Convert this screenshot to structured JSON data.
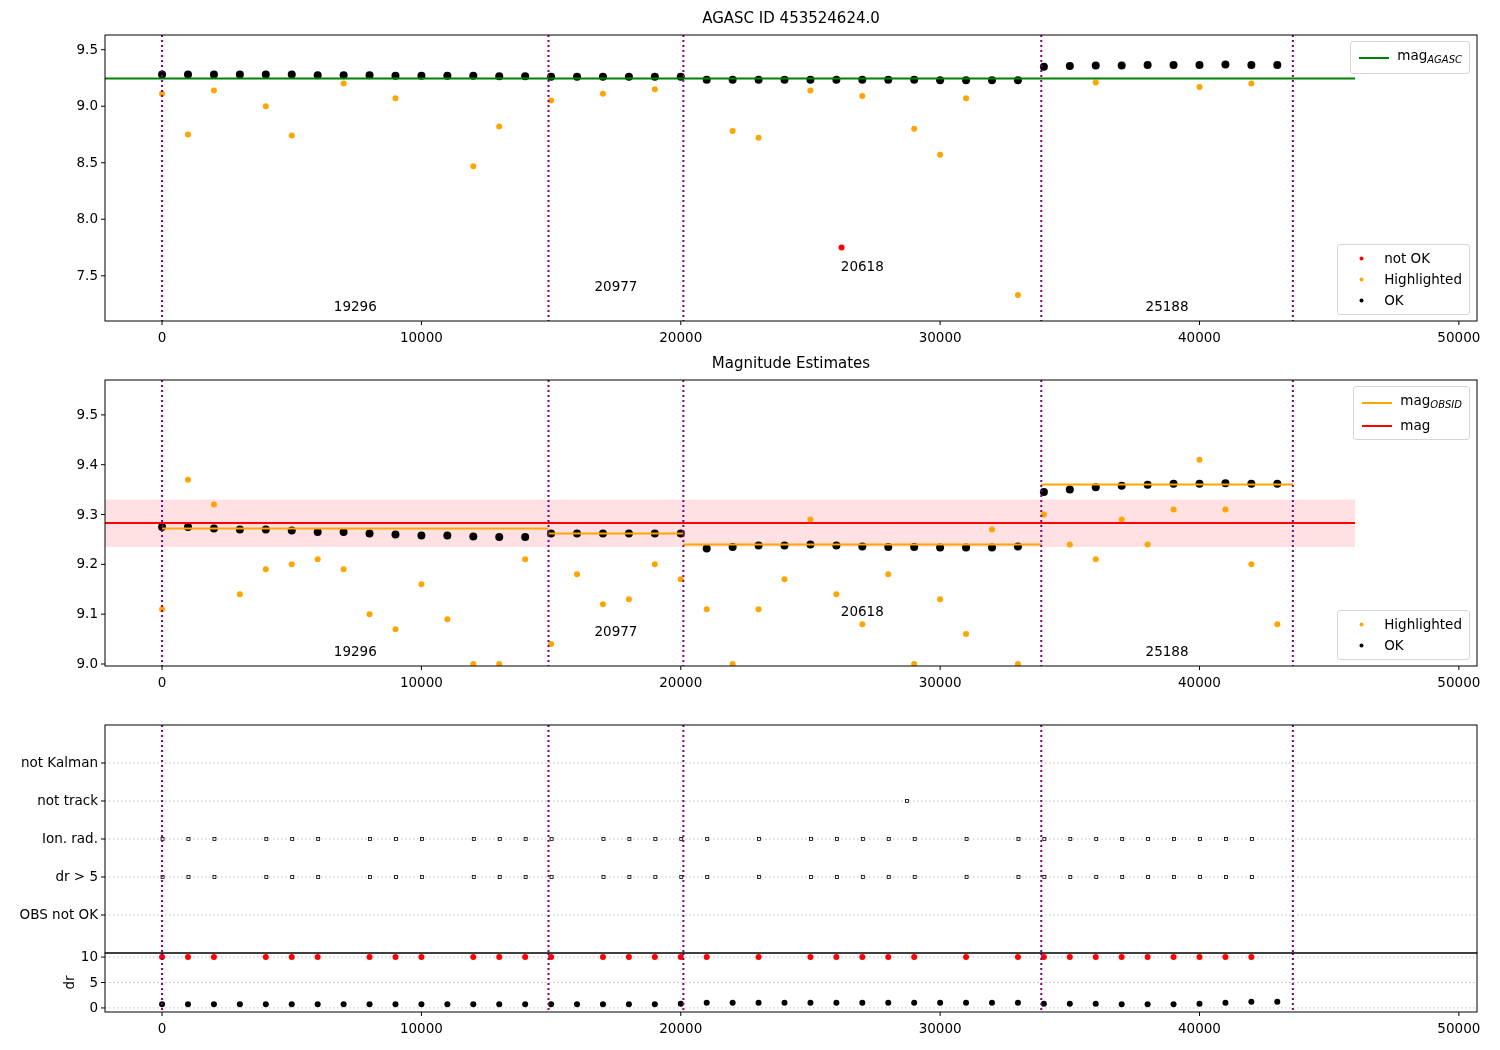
{
  "panels": [
    {
      "subplots": [
        {
          "chart_data": {
            "type": "scatter",
            "title": "AGASC ID 453524624.0",
            "xlim": [
              -2200,
              50700
            ],
            "ylim": [
              7.1,
              9.63
            ],
            "xticks": [
              0,
              10000,
              20000,
              30000,
              40000,
              50000
            ],
            "yticks": [
              {
                "value": 7.5,
                "label": "7.5"
              },
              {
                "value": 8,
                "label": "8.0"
              },
              {
                "value": 8.5,
                "label": "8.5"
              },
              {
                "value": 9,
                "label": "9.0"
              },
              {
                "value": 9.5,
                "label": "9.5"
              }
            ],
            "series": [
              {
                "type": "line",
                "color": "#008000",
                "x": [
                  -2200,
                  46000
                ],
                "values": [
                  9.245,
                  9.245
                ]
              },
              {
                "type": "scatter",
                "color": "#ff0000",
                "x": [
                  26200
                ],
                "values": [
                  7.75
                ]
              },
              {
                "type": "scatter",
                "color": "#ffa500",
                "x": [
                  0,
                  1000,
                  2000,
                  4000,
                  5000,
                  7000,
                  9000,
                  12000,
                  13000,
                  15000,
                  17000,
                  19000,
                  22000,
                  23000,
                  25000,
                  27000,
                  29000,
                  30000,
                  31000,
                  33000,
                  36000,
                  40000,
                  42000
                ],
                "values": [
                  9.11,
                  8.75,
                  9.14,
                  9.0,
                  8.74,
                  9.2,
                  9.07,
                  8.47,
                  8.82,
                  9.05,
                  9.11,
                  9.15,
                  8.78,
                  8.72,
                  9.14,
                  9.09,
                  8.8,
                  8.57,
                  9.07,
                  7.33,
                  9.21,
                  9.17,
                  9.2
                ]
              },
              {
                "type": "scatter",
                "color": "#000000",
                "x": [
                  0,
                  1000,
                  2000,
                  3000,
                  4000,
                  5000,
                  6000,
                  7000,
                  8000,
                  9000,
                  10000,
                  11000,
                  12000,
                  13000,
                  14000,
                  15000,
                  16000,
                  17000,
                  18000,
                  19000,
                  20000,
                  21000,
                  22000,
                  23000,
                  24000,
                  25000,
                  26000,
                  27000,
                  28000,
                  29000,
                  30000,
                  31000,
                  32000,
                  33000,
                  34000,
                  35000,
                  36000,
                  37000,
                  38000,
                  39000,
                  40000,
                  41000,
                  42000,
                  43000
                ],
                "values": [
                  9.28,
                  9.28,
                  9.28,
                  9.28,
                  9.28,
                  9.28,
                  9.275,
                  9.275,
                  9.275,
                  9.27,
                  9.27,
                  9.27,
                  9.27,
                  9.265,
                  9.265,
                  9.26,
                  9.26,
                  9.26,
                  9.26,
                  9.26,
                  9.26,
                  9.235,
                  9.235,
                  9.235,
                  9.235,
                  9.235,
                  9.235,
                  9.235,
                  9.235,
                  9.235,
                  9.23,
                  9.23,
                  9.23,
                  9.23,
                  9.35,
                  9.355,
                  9.36,
                  9.36,
                  9.365,
                  9.365,
                  9.365,
                  9.37,
                  9.365,
                  9.365
                ]
              }
            ],
            "ref_lines": [
              {
                "axis": "x",
                "value": 0
              },
              {
                "axis": "x",
                "value": 14900
              },
              {
                "axis": "x",
                "value": 20100
              },
              {
                "axis": "x",
                "value": 33900
              },
              {
                "axis": "x",
                "value": 43600
              }
            ]
          },
          "obsid_labels": [
            "19296",
            "20977",
            "20618",
            "25188"
          ],
          "legends": [
            {
              "entries": [
                {
                  "label": "mag$_{AGASC}$",
                  "kind": "line",
                  "color": "#008000"
                }
              ]
            },
            {
              "entries": [
                {
                  "label": "not OK",
                  "kind": "dot",
                  "color": "#ff0000"
                },
                {
                  "label": "Highlighted",
                  "kind": "dot",
                  "color": "#ffa500"
                },
                {
                  "label": "OK",
                  "kind": "dot",
                  "color": "#000000"
                }
              ]
            }
          ]
        }
      ]
    },
    {
      "subplots": [
        {
          "chart_data": {
            "type": "scatter",
            "title": "Magnitude Estimates",
            "xlim": [
              -2200,
              50700
            ],
            "ylim": [
              8.996,
              9.57
            ],
            "xticks": [
              0,
              10000,
              20000,
              30000,
              40000,
              50000
            ],
            "yticks": [
              {
                "value": 9,
                "label": "9.0"
              },
              {
                "value": 9.1,
                "label": "9.1"
              },
              {
                "value": 9.2,
                "label": "9.2"
              },
              {
                "value": 9.3,
                "label": "9.3"
              },
              {
                "value": 9.4,
                "label": "9.4"
              },
              {
                "value": 9.5,
                "label": "9.5"
              }
            ],
            "series": [
              {
                "type": "line",
                "color": "#ffa500",
                "x": [
                  0,
                  14900
                ],
                "values": [
                  9.272,
                  9.272
                ]
              },
              {
                "type": "line",
                "color": "#ffa500",
                "x": [
                  14900,
                  20100
                ],
                "values": [
                  9.262,
                  9.262
                ]
              },
              {
                "type": "line",
                "color": "#ffa500",
                "x": [
                  20100,
                  33900
                ],
                "values": [
                  9.24,
                  9.24
                ]
              },
              {
                "type": "line",
                "color": "#ffa500",
                "x": [
                  33900,
                  43600
                ],
                "values": [
                  9.36,
                  9.36
                ]
              },
              {
                "type": "line",
                "color": "#ff0000",
                "x": [
                  -2200,
                  46000
                ],
                "values": [
                  9.283,
                  9.283
                ]
              },
              {
                "type": "scatter",
                "color": "#ffa500",
                "x": [
                  0,
                  1000,
                  2000,
                  3000,
                  4000,
                  5000,
                  6000,
                  7000,
                  8000,
                  9000,
                  10000,
                  11000,
                  12000,
                  13000,
                  14000,
                  15000,
                  16000,
                  17000,
                  18000,
                  19000,
                  20000,
                  21000,
                  22000,
                  23000,
                  24000,
                  25000,
                  26000,
                  27000,
                  28000,
                  29000,
                  30000,
                  31000,
                  32000,
                  33000,
                  34000,
                  35000,
                  36000,
                  37000,
                  38000,
                  39000,
                  40000,
                  41000,
                  42000,
                  43000
                ],
                "values": [
                  9.11,
                  9.37,
                  9.32,
                  9.14,
                  9.19,
                  9.2,
                  9.21,
                  9.19,
                  9.1,
                  9.07,
                  9.16,
                  9.09,
                  9.0,
                  9.0,
                  9.21,
                  9.04,
                  9.18,
                  9.12,
                  9.13,
                  9.2,
                  9.17,
                  9.11,
                  9.0,
                  9.11,
                  9.17,
                  9.29,
                  9.14,
                  9.08,
                  9.18,
                  9.0,
                  9.13,
                  9.06,
                  9.27,
                  9.0,
                  9.3,
                  9.24,
                  9.21,
                  9.29,
                  9.24,
                  9.31,
                  9.41,
                  9.31,
                  9.2,
                  9.08
                ]
              },
              {
                "type": "scatter",
                "color": "#000000",
                "x": [
                  0,
                  1000,
                  2000,
                  3000,
                  4000,
                  5000,
                  6000,
                  7000,
                  8000,
                  9000,
                  10000,
                  11000,
                  12000,
                  13000,
                  14000,
                  15000,
                  16000,
                  17000,
                  18000,
                  19000,
                  20000,
                  21000,
                  22000,
                  23000,
                  24000,
                  25000,
                  26000,
                  27000,
                  28000,
                  29000,
                  30000,
                  31000,
                  32000,
                  33000,
                  34000,
                  35000,
                  36000,
                  37000,
                  38000,
                  39000,
                  40000,
                  41000,
                  42000,
                  43000
                ],
                "values": [
                  9.275,
                  9.275,
                  9.272,
                  9.27,
                  9.27,
                  9.268,
                  9.265,
                  9.265,
                  9.262,
                  9.26,
                  9.258,
                  9.258,
                  9.256,
                  9.255,
                  9.255,
                  9.262,
                  9.262,
                  9.262,
                  9.262,
                  9.262,
                  9.262,
                  9.232,
                  9.235,
                  9.238,
                  9.238,
                  9.24,
                  9.238,
                  9.236,
                  9.235,
                  9.235,
                  9.234,
                  9.234,
                  9.234,
                  9.236,
                  9.345,
                  9.35,
                  9.355,
                  9.358,
                  9.36,
                  9.362,
                  9.362,
                  9.363,
                  9.362,
                  9.362
                ]
              }
            ],
            "bands": [
              {
                "axis": "y",
                "from": 9.235,
                "to": 9.33
              }
            ],
            "ref_lines": [
              {
                "axis": "x",
                "value": 0
              },
              {
                "axis": "x",
                "value": 14900
              },
              {
                "axis": "x",
                "value": 20100
              },
              {
                "axis": "x",
                "value": 33900
              },
              {
                "axis": "x",
                "value": 43600
              }
            ]
          },
          "obsid_labels": [
            "19296",
            "20977",
            "20618",
            "25188"
          ],
          "legends": [
            {
              "entries": [
                {
                  "label": "mag$_{OBSID}$",
                  "kind": "line",
                  "color": "#ffa500"
                },
                {
                  "label": "mag",
                  "kind": "line",
                  "color": "#ff0000"
                }
              ]
            },
            {
              "entries": [
                {
                  "label": "Highlighted",
                  "kind": "dot",
                  "color": "#ffa500"
                },
                {
                  "label": "OK",
                  "kind": "dot",
                  "color": "#000000"
                }
              ]
            }
          ]
        }
      ]
    },
    {
      "subplots": [
        {
          "chart_data": {
            "type": "scatter",
            "orientation": "horizontal",
            "grid": true,
            "xlim": [
              -2200,
              50700
            ],
            "categories": [
              "not Kalman",
              "not track",
              "Ion. rad.",
              "dr > 5",
              "OBS not OK"
            ],
            "series": [
              {
                "type": "scatter",
                "color": "#000000",
                "values": [
                  null,
                  null,
                  0,
                  0,
                  null
                ]
              },
              {
                "type": "scatter",
                "color": "#000000",
                "values": [
                  null,
                  null,
                  1000,
                  1000,
                  null
                ]
              },
              {
                "type": "scatter",
                "color": "#000000",
                "values": [
                  null,
                  null,
                  2000,
                  2000,
                  null
                ]
              },
              {
                "type": "scatter",
                "color": "#000000",
                "values": [
                  null,
                  null,
                  4000,
                  4000,
                  null
                ]
              },
              {
                "type": "scatter",
                "color": "#000000",
                "values": [
                  null,
                  null,
                  5000,
                  5000,
                  null
                ]
              },
              {
                "type": "scatter",
                "color": "#000000",
                "values": [
                  null,
                  null,
                  6000,
                  6000,
                  null
                ]
              },
              {
                "type": "scatter",
                "color": "#000000",
                "values": [
                  null,
                  null,
                  8000,
                  8000,
                  null
                ]
              },
              {
                "type": "scatter",
                "color": "#000000",
                "values": [
                  null,
                  null,
                  9000,
                  9000,
                  null
                ]
              },
              {
                "type": "scatter",
                "color": "#000000",
                "values": [
                  null,
                  null,
                  10000,
                  10000,
                  null
                ]
              },
              {
                "type": "scatter",
                "color": "#000000",
                "values": [
                  null,
                  null,
                  12000,
                  12000,
                  null
                ]
              },
              {
                "type": "scatter",
                "color": "#000000",
                "values": [
                  null,
                  null,
                  13000,
                  13000,
                  null
                ]
              },
              {
                "type": "scatter",
                "color": "#000000",
                "values": [
                  null,
                  null,
                  14000,
                  14000,
                  null
                ]
              },
              {
                "type": "scatter",
                "color": "#000000",
                "values": [
                  null,
                  null,
                  15000,
                  15000,
                  null
                ]
              },
              {
                "type": "scatter",
                "color": "#000000",
                "values": [
                  null,
                  null,
                  17000,
                  17000,
                  null
                ]
              },
              {
                "type": "scatter",
                "color": "#000000",
                "values": [
                  null,
                  null,
                  18000,
                  18000,
                  null
                ]
              },
              {
                "type": "scatter",
                "color": "#000000",
                "values": [
                  null,
                  null,
                  19000,
                  19000,
                  null
                ]
              },
              {
                "type": "scatter",
                "color": "#000000",
                "values": [
                  null,
                  null,
                  20000,
                  20000,
                  null
                ]
              },
              {
                "type": "scatter",
                "color": "#000000",
                "values": [
                  null,
                  null,
                  21000,
                  21000,
                  null
                ]
              },
              {
                "type": "scatter",
                "color": "#000000",
                "values": [
                  null,
                  null,
                  23000,
                  23000,
                  null
                ]
              },
              {
                "type": "scatter",
                "color": "#000000",
                "values": [
                  null,
                  null,
                  25000,
                  25000,
                  null
                ]
              },
              {
                "type": "scatter",
                "color": "#000000",
                "values": [
                  null,
                  null,
                  26000,
                  26000,
                  null
                ]
              },
              {
                "type": "scatter",
                "color": "#000000",
                "values": [
                  null,
                  null,
                  27000,
                  27000,
                  null
                ]
              },
              {
                "type": "scatter",
                "color": "#000000",
                "values": [
                  null,
                  null,
                  28000,
                  28000,
                  null
                ]
              },
              {
                "type": "scatter",
                "color": "#000000",
                "values": [
                  null,
                  null,
                  29000,
                  29000,
                  null
                ]
              },
              {
                "type": "scatter",
                "color": "#000000",
                "values": [
                  null,
                  null,
                  31000,
                  31000,
                  null
                ]
              },
              {
                "type": "scatter",
                "color": "#000000",
                "values": [
                  null,
                  null,
                  33000,
                  33000,
                  null
                ]
              },
              {
                "type": "scatter",
                "color": "#000000",
                "values": [
                  null,
                  null,
                  34000,
                  34000,
                  null
                ]
              },
              {
                "type": "scatter",
                "color": "#000000",
                "values": [
                  null,
                  null,
                  35000,
                  35000,
                  null
                ]
              },
              {
                "type": "scatter",
                "color": "#000000",
                "values": [
                  null,
                  null,
                  36000,
                  36000,
                  null
                ]
              },
              {
                "type": "scatter",
                "color": "#000000",
                "values": [
                  null,
                  null,
                  37000,
                  37000,
                  null
                ]
              },
              {
                "type": "scatter",
                "color": "#000000",
                "values": [
                  null,
                  null,
                  38000,
                  38000,
                  null
                ]
              },
              {
                "type": "scatter",
                "color": "#000000",
                "values": [
                  null,
                  null,
                  39000,
                  39000,
                  null
                ]
              },
              {
                "type": "scatter",
                "color": "#000000",
                "values": [
                  null,
                  null,
                  40000,
                  40000,
                  null
                ]
              },
              {
                "type": "scatter",
                "color": "#000000",
                "values": [
                  null,
                  null,
                  41000,
                  41000,
                  null
                ]
              },
              {
                "type": "scatter",
                "color": "#000000",
                "values": [
                  null,
                  null,
                  42000,
                  42000,
                  null
                ]
              },
              {
                "type": "scatter",
                "color": "#000000",
                "values": [
                  null,
                  28700,
                  null,
                  null,
                  null
                ]
              }
            ],
            "ref_lines": [
              {
                "axis": "x",
                "value": 0
              },
              {
                "axis": "x",
                "value": 14900
              },
              {
                "axis": "x",
                "value": 20100
              },
              {
                "axis": "x",
                "value": 33900
              },
              {
                "axis": "x",
                "value": 43600
              }
            ]
          }
        },
        {
          "chart_data": {
            "type": "scatter",
            "ylabel": "dr",
            "grid": true,
            "xlim": [
              -2200,
              50700
            ],
            "ylim": [
              -0.8,
              10.8
            ],
            "xticks": [
              0,
              10000,
              20000,
              30000,
              40000,
              50000
            ],
            "yticks": [
              0,
              5,
              10
            ],
            "series": [
              {
                "type": "scatter",
                "color": "#ff0000",
                "x": [
                  0,
                  1000,
                  2000,
                  4000,
                  5000,
                  6000,
                  8000,
                  9000,
                  10000,
                  12000,
                  13000,
                  14000,
                  15000,
                  17000,
                  18000,
                  19000,
                  20000,
                  21000,
                  23000,
                  25000,
                  26000,
                  27000,
                  28000,
                  29000,
                  31000,
                  33000,
                  34000,
                  35000,
                  36000,
                  37000,
                  38000,
                  39000,
                  40000,
                  41000,
                  42000
                ],
                "values": [
                  10,
                  10,
                  10,
                  10,
                  10,
                  10,
                  10,
                  10,
                  10,
                  10,
                  10,
                  10,
                  10,
                  10,
                  10,
                  10,
                  10,
                  10,
                  10,
                  10,
                  10,
                  10,
                  10,
                  10,
                  10,
                  10,
                  10,
                  10,
                  10,
                  10,
                  10,
                  10,
                  10,
                  10,
                  10
                ]
              },
              {
                "type": "scatter",
                "color": "#000000",
                "x": [
                  0,
                  1000,
                  2000,
                  3000,
                  4000,
                  5000,
                  6000,
                  7000,
                  8000,
                  9000,
                  10000,
                  11000,
                  12000,
                  13000,
                  14000,
                  15000,
                  16000,
                  17000,
                  18000,
                  19000,
                  20000,
                  21000,
                  22000,
                  23000,
                  24000,
                  25000,
                  26000,
                  27000,
                  28000,
                  29000,
                  30000,
                  31000,
                  32000,
                  33000,
                  34000,
                  35000,
                  36000,
                  37000,
                  38000,
                  39000,
                  40000,
                  41000,
                  42000,
                  43000
                ],
                "values": [
                  0.7,
                  0.7,
                  0.7,
                  0.7,
                  0.7,
                  0.7,
                  0.7,
                  0.7,
                  0.7,
                  0.7,
                  0.7,
                  0.7,
                  0.7,
                  0.7,
                  0.7,
                  0.7,
                  0.7,
                  0.7,
                  0.7,
                  0.7,
                  0.8,
                  1,
                  1,
                  1,
                  1,
                  1,
                  1,
                  1,
                  1,
                  1,
                  1,
                  1,
                  1,
                  1,
                  0.8,
                  0.8,
                  0.8,
                  0.7,
                  0.7,
                  0.7,
                  0.8,
                  1,
                  1.2,
                  1.2
                ]
              }
            ],
            "ref_lines": [
              {
                "axis": "x",
                "value": 0
              },
              {
                "axis": "x",
                "value": 14900
              },
              {
                "axis": "x",
                "value": 20100
              },
              {
                "axis": "x",
                "value": 33900
              },
              {
                "axis": "x",
                "value": 43600
              }
            ]
          }
        }
      ]
    }
  ]
}
